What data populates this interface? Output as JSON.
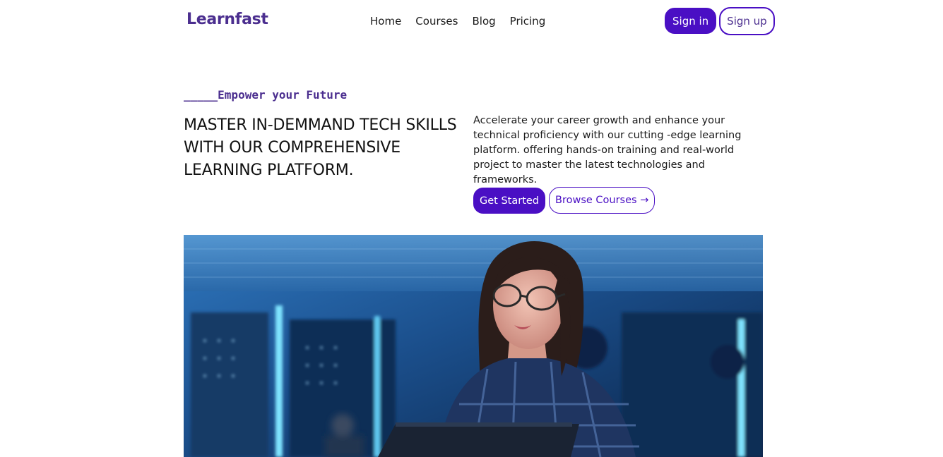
{
  "brand": {
    "name": "Learnfast"
  },
  "nav": {
    "items": [
      {
        "label": "Home"
      },
      {
        "label": "Courses"
      },
      {
        "label": "Blog"
      },
      {
        "label": "Pricing"
      }
    ]
  },
  "auth": {
    "signin_label": "Sign in",
    "signup_label": "Sign up"
  },
  "hero": {
    "eyebrow": "_____Empower your Future",
    "headline": "MASTER IN-DEMMAND TECH SKILLS WITH OUR COMPREHENSIVE LEARNING PLATFORM.",
    "lead": "Accelerate your career growth and enhance your technical proficiency with our cutting -edge learning platform. offering hands-on training and real-world project to master the latest technologies and frameworks.",
    "primary_cta": "Get Started",
    "secondary_cta": "Browse Courses →"
  },
  "colors": {
    "accent": "#4a0fc4",
    "brand": "#4b2e8f",
    "text": "#1a1a1a"
  }
}
